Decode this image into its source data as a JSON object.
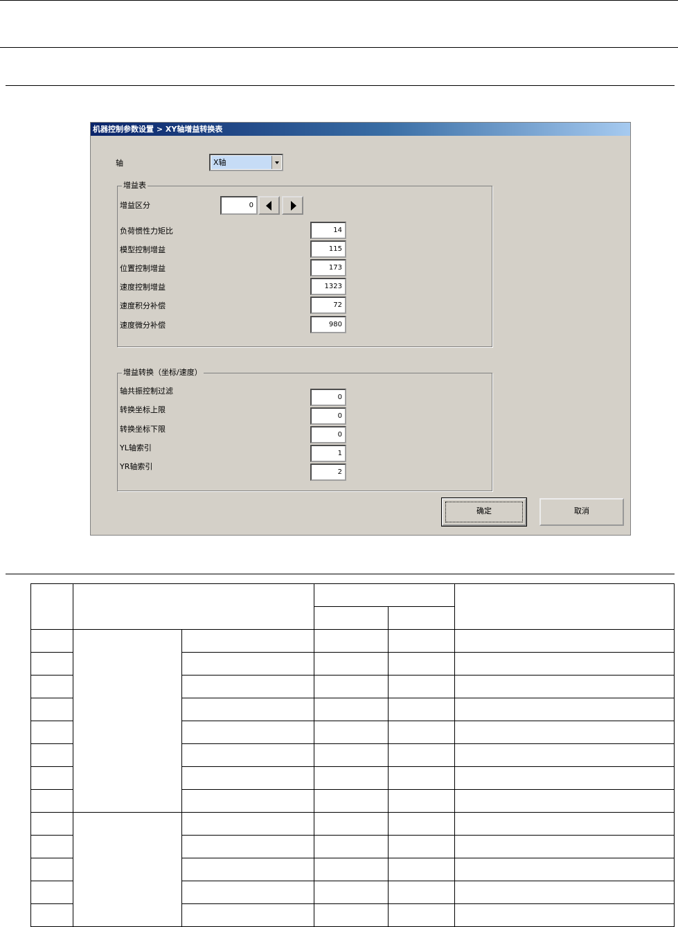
{
  "dialog": {
    "title": "机器控制参数设置 > XY轴增益转换表",
    "axis_label": "轴",
    "axis_value": "X轴",
    "gain_table": {
      "legend": "增益表",
      "division_label": "增益区分",
      "division_value": "0",
      "rows": [
        {
          "label": "负荷惯性力矩比",
          "value": "14"
        },
        {
          "label": "模型控制增益",
          "value": "115"
        },
        {
          "label": "位置控制增益",
          "value": "173"
        },
        {
          "label": "速度控制增益",
          "value": "1323"
        },
        {
          "label": "速度积分补偿",
          "value": "72"
        },
        {
          "label": "速度微分补偿",
          "value": "980"
        }
      ]
    },
    "gain_switch": {
      "legend": "增益转换（坐标/速度）",
      "rows": [
        {
          "label": "轴共振控制过滤",
          "value": "0"
        },
        {
          "label": "转换坐标上限",
          "value": "0"
        },
        {
          "label": "转换坐标下限",
          "value": "0"
        },
        {
          "label": "YL轴索引",
          "value": "1"
        },
        {
          "label": "YR轴索引",
          "value": "2"
        }
      ]
    },
    "ok_label": "确定",
    "cancel_label": "取消"
  }
}
